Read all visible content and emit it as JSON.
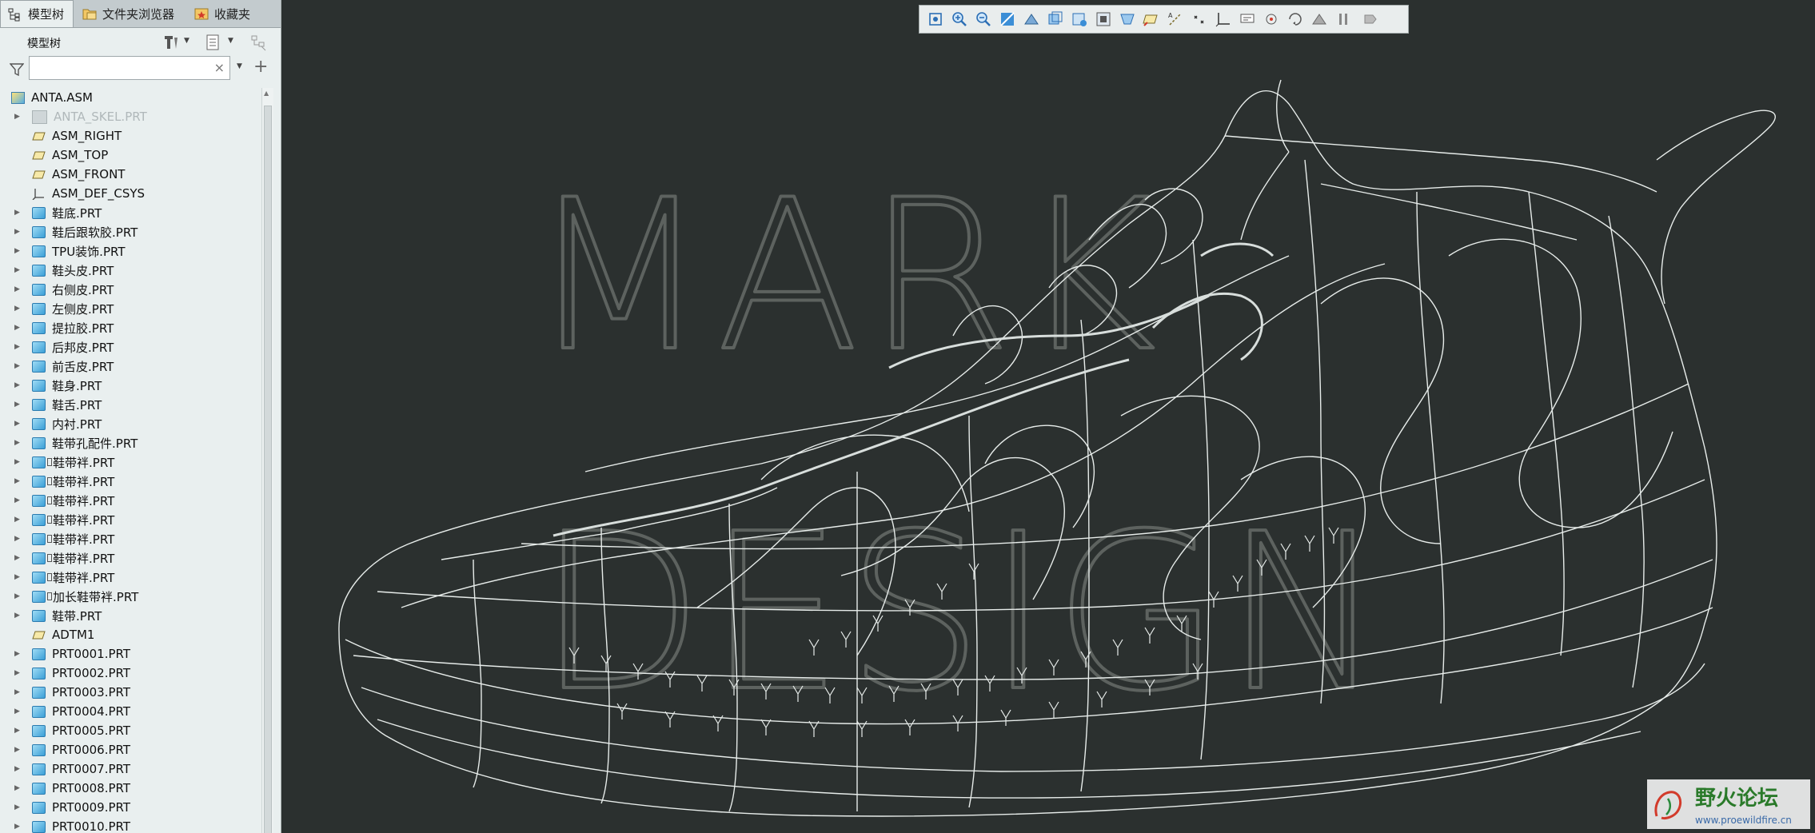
{
  "tabs": [
    {
      "label": "模型树",
      "icon": "tree-icon"
    },
    {
      "label": "文件夹浏览器",
      "icon": "folder-browser-icon"
    },
    {
      "label": "收藏夹",
      "icon": "favorites-icon"
    }
  ],
  "model_tree": {
    "title": "模型树",
    "search": {
      "value": "",
      "placeholder": ""
    },
    "items": [
      {
        "label": "ANTA.ASM",
        "icon": "assembly-icon",
        "expandable": false,
        "root": true
      },
      {
        "label": "ANTA_SKEL.PRT",
        "icon": "skeleton-part-icon",
        "expandable": true,
        "faded": true
      },
      {
        "label": "ASM_RIGHT",
        "icon": "datum-plane-icon",
        "expandable": false
      },
      {
        "label": "ASM_TOP",
        "icon": "datum-plane-icon",
        "expandable": false
      },
      {
        "label": "ASM_FRONT",
        "icon": "datum-plane-icon",
        "expandable": false
      },
      {
        "label": "ASM_DEF_CSYS",
        "icon": "csys-icon",
        "expandable": false
      },
      {
        "label": "鞋底.PRT",
        "icon": "part-icon",
        "expandable": true
      },
      {
        "label": "鞋后跟软胶.PRT",
        "icon": "part-icon",
        "expandable": true
      },
      {
        "label": "TPU装饰.PRT",
        "icon": "part-icon",
        "expandable": true
      },
      {
        "label": "鞋头皮.PRT",
        "icon": "part-icon",
        "expandable": true
      },
      {
        "label": "右侧皮.PRT",
        "icon": "part-icon",
        "expandable": true
      },
      {
        "label": "左侧皮.PRT",
        "icon": "part-icon",
        "expandable": true
      },
      {
        "label": "提拉胶.PRT",
        "icon": "part-icon",
        "expandable": true
      },
      {
        "label": "后邦皮.PRT",
        "icon": "part-icon",
        "expandable": true
      },
      {
        "label": "前舌皮.PRT",
        "icon": "part-icon",
        "expandable": true
      },
      {
        "label": "鞋身.PRT",
        "icon": "part-icon",
        "expandable": true
      },
      {
        "label": "鞋舌.PRT",
        "icon": "part-icon",
        "expandable": true
      },
      {
        "label": "内衬.PRT",
        "icon": "part-icon",
        "expandable": true
      },
      {
        "label": "鞋带孔配件.PRT",
        "icon": "part-icon",
        "expandable": true
      },
      {
        "label": "鞋带袢.PRT",
        "icon": "part-icon",
        "expandable": true,
        "marker": true
      },
      {
        "label": "鞋带袢.PRT",
        "icon": "part-icon",
        "expandable": true,
        "marker": true
      },
      {
        "label": "鞋带袢.PRT",
        "icon": "part-icon",
        "expandable": true,
        "marker": true
      },
      {
        "label": "鞋带袢.PRT",
        "icon": "part-icon",
        "expandable": true,
        "marker": true
      },
      {
        "label": "鞋带袢.PRT",
        "icon": "part-icon",
        "expandable": true,
        "marker": true
      },
      {
        "label": "鞋带袢.PRT",
        "icon": "part-icon",
        "expandable": true,
        "marker": true
      },
      {
        "label": "鞋带袢.PRT",
        "icon": "part-icon",
        "expandable": true,
        "marker": true
      },
      {
        "label": "加长鞋带袢.PRT",
        "icon": "part-icon",
        "expandable": true,
        "marker": true
      },
      {
        "label": "鞋带.PRT",
        "icon": "part-icon",
        "expandable": true
      },
      {
        "label": "ADTM1",
        "icon": "datum-plane-icon",
        "expandable": false
      },
      {
        "label": "PRT0001.PRT",
        "icon": "part-icon",
        "expandable": true
      },
      {
        "label": "PRT0002.PRT",
        "icon": "part-icon",
        "expandable": true
      },
      {
        "label": "PRT0003.PRT",
        "icon": "part-icon",
        "expandable": true
      },
      {
        "label": "PRT0004.PRT",
        "icon": "part-icon",
        "expandable": true
      },
      {
        "label": "PRT0005.PRT",
        "icon": "part-icon",
        "expandable": true
      },
      {
        "label": "PRT0006.PRT",
        "icon": "part-icon",
        "expandable": true
      },
      {
        "label": "PRT0007.PRT",
        "icon": "part-icon",
        "expandable": true
      },
      {
        "label": "PRT0008.PRT",
        "icon": "part-icon",
        "expandable": true
      },
      {
        "label": "PRT0009.PRT",
        "icon": "part-icon",
        "expandable": true
      },
      {
        "label": "PRT0010.PRT",
        "icon": "part-icon",
        "expandable": true
      }
    ]
  },
  "graphics_toolbar": {
    "buttons": [
      "refit-icon",
      "zoom-in-icon",
      "zoom-out-icon",
      "repaint-icon",
      "orient-icon",
      "saved-views-icon",
      "display-style-icon",
      "view-manager-icon",
      "perspective-icon",
      "plane-display-icon",
      "axis-display-icon",
      "point-display-icon",
      "csys-display-icon",
      "annotation-display-icon",
      "spin-center-icon",
      "spin-icon",
      "mesh-icon",
      "pause-icon",
      "next-icon"
    ]
  },
  "viewport": {
    "overlay_text_line1": "MARK",
    "overlay_text_line2": "DESIGN",
    "background_color": "#2b302f"
  },
  "watermark": {
    "title": "野火论坛",
    "url": "www.proewildfire.cn"
  }
}
